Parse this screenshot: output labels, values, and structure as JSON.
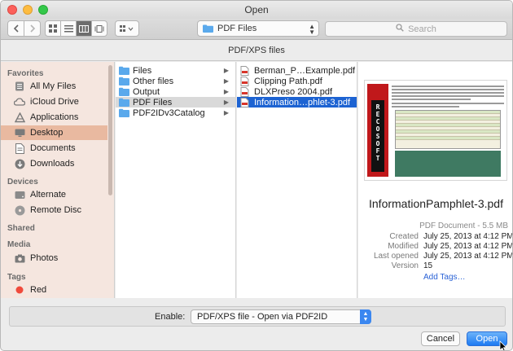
{
  "window": {
    "title": "Open"
  },
  "toolbar": {
    "path_selector": "PDF Files",
    "search_placeholder": "Search"
  },
  "filter_title": "PDF/XPS files",
  "sidebar": {
    "favorites_header": "Favorites",
    "favorites": [
      {
        "label": "All My Files",
        "icon": "all-files-icon"
      },
      {
        "label": "iCloud Drive",
        "icon": "cloud-icon"
      },
      {
        "label": "Applications",
        "icon": "applications-icon"
      },
      {
        "label": "Desktop",
        "icon": "desktop-icon",
        "selected": true
      },
      {
        "label": "Documents",
        "icon": "documents-icon"
      },
      {
        "label": "Downloads",
        "icon": "downloads-icon"
      }
    ],
    "devices_header": "Devices",
    "devices": [
      {
        "label": "Alternate",
        "icon": "disk-icon"
      },
      {
        "label": "Remote Disc",
        "icon": "disc-icon"
      }
    ],
    "shared_header": "Shared",
    "media_header": "Media",
    "media": [
      {
        "label": "Photos",
        "icon": "camera-icon"
      }
    ],
    "tags_header": "Tags",
    "tags": [
      {
        "label": "Red",
        "color": "#f04a3c"
      }
    ]
  },
  "column1": [
    {
      "label": "Files"
    },
    {
      "label": "Other files"
    },
    {
      "label": "Output"
    },
    {
      "label": "PDF Files",
      "selected": true
    },
    {
      "label": "PDF2IDv3Catalog"
    }
  ],
  "column2": [
    {
      "label": "Berman_P…Example.pdf"
    },
    {
      "label": "Clipping Path.pdf"
    },
    {
      "label": "DLXPreso 2004.pdf"
    },
    {
      "label": "Information…phlet-3.pdf",
      "selected": true
    }
  ],
  "preview": {
    "logo_text": "RECOSOFT",
    "filename": "InformationPamphlet-3.pdf",
    "kind": "PDF Document - 5.5 MB",
    "meta": [
      {
        "label": "Created",
        "value": "July 25, 2013 at 4:12 PM"
      },
      {
        "label": "Modified",
        "value": "July 25, 2013 at 4:12 PM"
      },
      {
        "label": "Last opened",
        "value": "July 25, 2013 at 4:12 PM"
      },
      {
        "label": "Version",
        "value": "15"
      }
    ],
    "add_tags": "Add Tags…"
  },
  "enable": {
    "label": "Enable:",
    "selected": "PDF/XPS file - Open via PDF2ID"
  },
  "buttons": {
    "cancel": "Cancel",
    "open": "Open"
  },
  "colors": {
    "accent": "#1d63d2",
    "sidebar_selected": "#e9b9a0",
    "sidebar_bg": "#f5e6df",
    "folder": "#5aa9ec"
  }
}
